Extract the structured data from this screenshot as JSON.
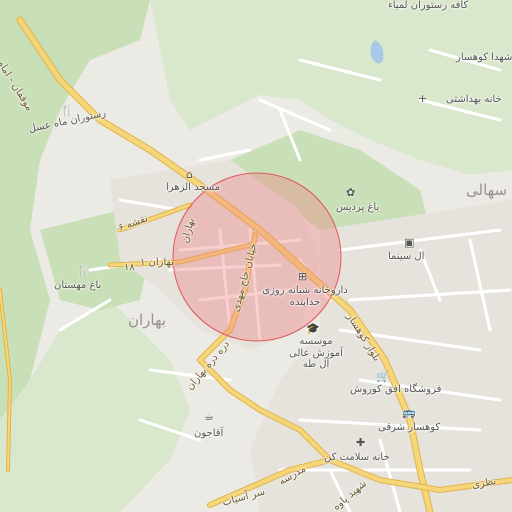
{
  "map": {
    "colors": {
      "land": "#eceae4",
      "green": "#c9dfb8",
      "green_light": "#d9e8cc",
      "road_major": "#f5d77a",
      "road_major_stroke": "#e2b24a",
      "road_minor": "#ffffff",
      "highlight_fill": "#f08080",
      "highlight_stroke": "#e05a5a",
      "water": "#a9c9e8",
      "area_text": "#9a8f8a"
    },
    "areas": {
      "baharan_big": "بهاران",
      "sohrab_big": "سهالی",
      "baharan_top": "بهاران"
    },
    "roads": {
      "mooghan": "موقفان - امام",
      "naghsheh": "نقشه ۶",
      "baharan_1": "بهاران ۱",
      "baharan_18": "۱۸",
      "haj_mehdi": "خیابان حاج مهدی",
      "daryaee": "دره دره بهاران",
      "kohsar_blvd": "بلوار کوهسار",
      "modares": "مدرسه",
      "asiab": "سر آسیاب",
      "nazari": "نظری",
      "shahid_paveh": "شهید پاوه"
    },
    "pois": {
      "lamiya_cafe": "کافه رستوران لمیاء",
      "kohsar_shohada": "شهدا کوهسار",
      "health_house": "خانه بهداشتی",
      "mahe_asal": "رستوران ماه عسل",
      "zahra_mosque": "مسجد الزهرا",
      "pardis_garden": "باغ پردیس",
      "el_cinema": "ال سینما",
      "pharmacy": "داروخانه شبانه روزی خداینده",
      "institute": "موسسه آموزش عالی آل طه",
      "mahestan_garden": "باغ مهستان",
      "kohsar_shop": "فروشگاه افق کوروش",
      "kohsar_east": "کوهسار شرقی",
      "salamat": "خانه سلامت کن",
      "aghajoon": "آقاجون"
    }
  }
}
